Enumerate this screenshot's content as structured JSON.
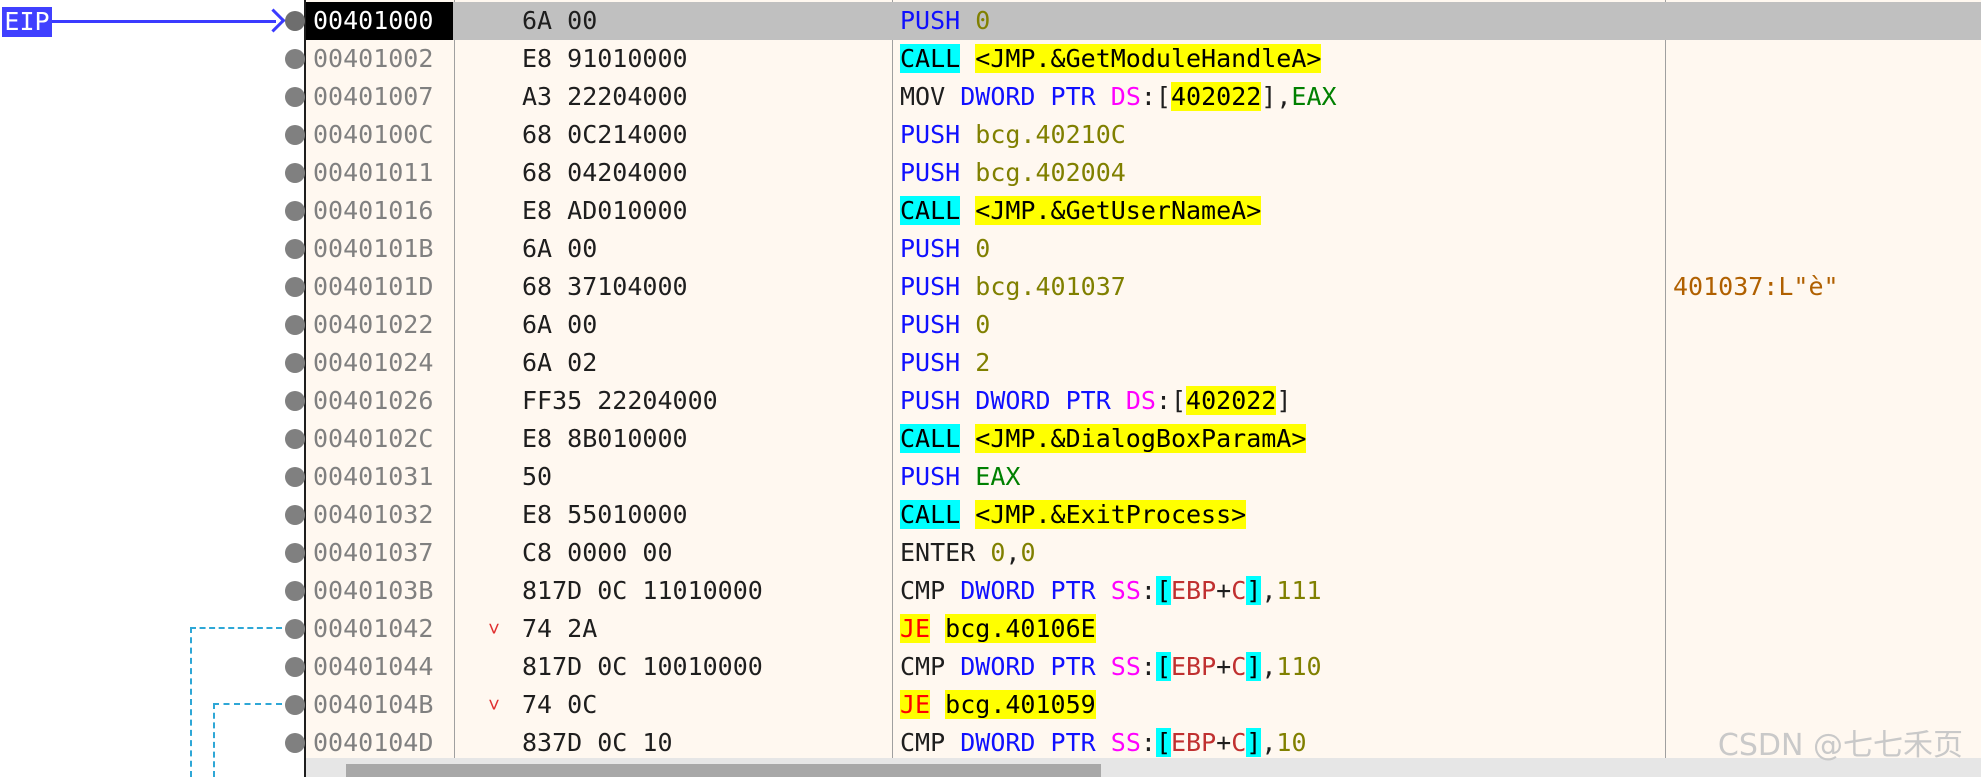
{
  "eip_label": "EIP",
  "watermark": "CSDN @七七禾页",
  "rows": [
    {
      "addr": "00401000",
      "bytes": "6A 00",
      "arrow": "",
      "mnemonic": "PUSH",
      "operands": [
        {
          "t": "0",
          "c": "op-olive"
        }
      ],
      "comment": ""
    },
    {
      "addr": "00401002",
      "bytes": "E8 91010000",
      "arrow": "",
      "mnemonic": "CALL",
      "operands": [
        {
          "t": "<JMP.&GetModuleHandleA>",
          "c": "op-label"
        }
      ],
      "comment": ""
    },
    {
      "addr": "00401007",
      "bytes": "A3 22204000",
      "arrow": "",
      "mnemonic": "MOV",
      "operands": [
        {
          "t": "DWORD",
          "c": "kw-blue"
        },
        {
          "t": " "
        },
        {
          "t": "PTR",
          "c": "kw-blue"
        },
        {
          "t": " "
        },
        {
          "t": "DS",
          "c": "op-seg"
        },
        {
          "t": ":["
        },
        {
          "t": "402022",
          "c": "op-addr-bg"
        },
        {
          "t": "],"
        },
        {
          "t": "EAX",
          "c": "op-green"
        }
      ],
      "comment": ""
    },
    {
      "addr": "0040100C",
      "bytes": "68 0C214000",
      "arrow": "",
      "mnemonic": "PUSH",
      "operands": [
        {
          "t": "bcg.40210C",
          "c": "op-olive"
        }
      ],
      "comment": ""
    },
    {
      "addr": "00401011",
      "bytes": "68 04204000",
      "arrow": "",
      "mnemonic": "PUSH",
      "operands": [
        {
          "t": "bcg.402004",
          "c": "op-olive"
        }
      ],
      "comment": ""
    },
    {
      "addr": "00401016",
      "bytes": "E8 AD010000",
      "arrow": "",
      "mnemonic": "CALL",
      "operands": [
        {
          "t": "<JMP.&GetUserNameA>",
          "c": "op-label"
        }
      ],
      "comment": ""
    },
    {
      "addr": "0040101B",
      "bytes": "6A 00",
      "arrow": "",
      "mnemonic": "PUSH",
      "operands": [
        {
          "t": "0",
          "c": "op-olive"
        }
      ],
      "comment": ""
    },
    {
      "addr": "0040101D",
      "bytes": "68 37104000",
      "arrow": "",
      "mnemonic": "PUSH",
      "operands": [
        {
          "t": "bcg.401037",
          "c": "op-olive"
        }
      ],
      "comment": "401037:L\"è\""
    },
    {
      "addr": "00401022",
      "bytes": "6A 00",
      "arrow": "",
      "mnemonic": "PUSH",
      "operands": [
        {
          "t": "0",
          "c": "op-olive"
        }
      ],
      "comment": ""
    },
    {
      "addr": "00401024",
      "bytes": "6A 02",
      "arrow": "",
      "mnemonic": "PUSH",
      "operands": [
        {
          "t": "2",
          "c": "op-olive"
        }
      ],
      "comment": ""
    },
    {
      "addr": "00401026",
      "bytes": "FF35 22204000",
      "arrow": "",
      "mnemonic": "PUSH",
      "operands": [
        {
          "t": "DWORD",
          "c": "kw-blue"
        },
        {
          "t": " "
        },
        {
          "t": "PTR",
          "c": "kw-blue"
        },
        {
          "t": " "
        },
        {
          "t": "DS",
          "c": "op-seg"
        },
        {
          "t": ":["
        },
        {
          "t": "402022",
          "c": "op-addr-bg"
        },
        {
          "t": "]"
        }
      ],
      "comment": ""
    },
    {
      "addr": "0040102C",
      "bytes": "E8 8B010000",
      "arrow": "",
      "mnemonic": "CALL",
      "operands": [
        {
          "t": "<JMP.&DialogBoxParamA>",
          "c": "op-label"
        }
      ],
      "comment": ""
    },
    {
      "addr": "00401031",
      "bytes": "50",
      "arrow": "",
      "mnemonic": "PUSH",
      "operands": [
        {
          "t": "EAX",
          "c": "op-green"
        }
      ],
      "comment": ""
    },
    {
      "addr": "00401032",
      "bytes": "E8 55010000",
      "arrow": "",
      "mnemonic": "CALL",
      "operands": [
        {
          "t": "<JMP.&ExitProcess>",
          "c": "op-label"
        }
      ],
      "comment": ""
    },
    {
      "addr": "00401037",
      "bytes": "C8 0000 00",
      "arrow": "",
      "mnemonic": "ENTER",
      "operands": [
        {
          "t": "0",
          "c": "op-olive"
        },
        {
          "t": ","
        },
        {
          "t": "0",
          "c": "op-olive"
        }
      ],
      "comment": ""
    },
    {
      "addr": "0040103B",
      "bytes": "817D 0C 11010000",
      "arrow": "",
      "mnemonic": "CMP",
      "operands": [
        {
          "t": "DWORD",
          "c": "kw-blue"
        },
        {
          "t": " "
        },
        {
          "t": "PTR",
          "c": "kw-blue"
        },
        {
          "t": " "
        },
        {
          "t": "SS",
          "c": "op-seg"
        },
        {
          "t": ":"
        },
        {
          "t": "[",
          "c": "op-brk"
        },
        {
          "t": "EBP",
          "c": "op-reg"
        },
        {
          "t": "+"
        },
        {
          "t": "C",
          "c": "op-reg"
        },
        {
          "t": "]",
          "c": "op-brk"
        },
        {
          "t": ","
        },
        {
          "t": "111",
          "c": "op-olive"
        }
      ],
      "comment": ""
    },
    {
      "addr": "00401042",
      "bytes": "74 2A",
      "arrow": "˅",
      "mnemonic": "JE",
      "operands": [
        {
          "t": "bcg.40106E",
          "c": "op-label"
        }
      ],
      "comment": ""
    },
    {
      "addr": "00401044",
      "bytes": "817D 0C 10010000",
      "arrow": "",
      "mnemonic": "CMP",
      "operands": [
        {
          "t": "DWORD",
          "c": "kw-blue"
        },
        {
          "t": " "
        },
        {
          "t": "PTR",
          "c": "kw-blue"
        },
        {
          "t": " "
        },
        {
          "t": "SS",
          "c": "op-seg"
        },
        {
          "t": ":"
        },
        {
          "t": "[",
          "c": "op-brk"
        },
        {
          "t": "EBP",
          "c": "op-reg"
        },
        {
          "t": "+"
        },
        {
          "t": "C",
          "c": "op-reg"
        },
        {
          "t": "]",
          "c": "op-brk"
        },
        {
          "t": ","
        },
        {
          "t": "110",
          "c": "op-olive"
        }
      ],
      "comment": ""
    },
    {
      "addr": "0040104B",
      "bytes": "74 0C",
      "arrow": "˅",
      "mnemonic": "JE",
      "operands": [
        {
          "t": "bcg.401059",
          "c": "op-label"
        }
      ],
      "comment": ""
    },
    {
      "addr": "0040104D",
      "bytes": "837D 0C 10",
      "arrow": "",
      "mnemonic": "CMP",
      "operands": [
        {
          "t": "DWORD",
          "c": "kw-blue"
        },
        {
          "t": " "
        },
        {
          "t": "PTR",
          "c": "kw-blue"
        },
        {
          "t": " "
        },
        {
          "t": "SS",
          "c": "op-seg"
        },
        {
          "t": ":"
        },
        {
          "t": "[",
          "c": "op-brk"
        },
        {
          "t": "EBP",
          "c": "op-reg"
        },
        {
          "t": "+"
        },
        {
          "t": "C",
          "c": "op-reg"
        },
        {
          "t": "]",
          "c": "op-brk"
        },
        {
          "t": ","
        },
        {
          "t": "10",
          "c": "op-olive"
        }
      ],
      "comment": ""
    }
  ]
}
